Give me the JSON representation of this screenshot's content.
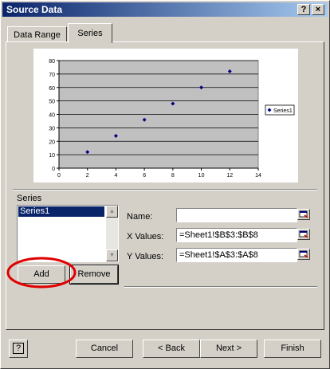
{
  "window": {
    "title": "Source Data"
  },
  "titlebar": {
    "help": "?",
    "close": "×"
  },
  "tabs": [
    {
      "label": "Data Range"
    },
    {
      "label": "Series"
    }
  ],
  "chart_data": {
    "type": "scatter",
    "x": [
      2,
      4,
      6,
      8,
      10,
      12
    ],
    "y": [
      12,
      24,
      36,
      48,
      60,
      72
    ],
    "series": [
      {
        "name": "Series1"
      }
    ],
    "xlim": [
      0,
      14
    ],
    "ylim": [
      0,
      80
    ],
    "xticks": [
      "0",
      "2",
      "4",
      "6",
      "8",
      "10",
      "12",
      "14"
    ],
    "yticks": [
      "0",
      "10",
      "20",
      "30",
      "40",
      "50",
      "60",
      "70",
      "80"
    ],
    "grid": true,
    "legend": "right",
    "colors": {
      "marker": "#000080",
      "plot_area": "#c0c0c0"
    }
  },
  "series_section": {
    "label": "Series",
    "items": [
      "Series1"
    ],
    "add": "Add",
    "remove": "Remove"
  },
  "fields": {
    "name": {
      "label": "Name:",
      "value": ""
    },
    "x_values": {
      "label": "X Values:",
      "value": "=Sheet1!$B$3:$B$8"
    },
    "y_values": {
      "label": "Y Values:",
      "value": "=Sheet1!$A$3:$A$8"
    }
  },
  "footer": {
    "help": "?",
    "cancel": "Cancel",
    "back": "< Back",
    "next": "Next >",
    "finish": "Finish"
  },
  "annotation": {
    "color": "#e00000"
  }
}
